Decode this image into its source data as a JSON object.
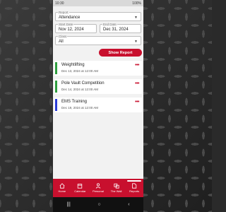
{
  "status": {
    "time": "10:30",
    "battery": "100%"
  },
  "filters": {
    "report": {
      "label": "Report",
      "value": "Attendance"
    },
    "start_date": {
      "label": "Start Date",
      "value": "Nov 12, 2024"
    },
    "end_date": {
      "label": "End Date",
      "value": "Dec 31, 2024"
    },
    "class": {
      "label": "Class",
      "value": "All"
    }
  },
  "show_report_label": "Show Report",
  "events": [
    {
      "title": "Weightlifting",
      "date": "Dec 13, 2024 at 12:00 AM",
      "color": "#2e9e3e"
    },
    {
      "title": "Pole Vault Competition",
      "date": "Dec 14, 2024 at 12:00 AM",
      "color": "#2e9e3e"
    },
    {
      "title": "EMS Training",
      "date": "Dec 19, 2024 at 12:00 AM",
      "color": "#2a3bd6"
    }
  ],
  "nav": [
    {
      "label": "Home",
      "icon": "home-icon"
    },
    {
      "label": "Calendar",
      "icon": "calendar-icon"
    },
    {
      "label": "Personal",
      "icon": "person-icon"
    },
    {
      "label": "The Wall",
      "icon": "wall-icon"
    },
    {
      "label": "Reports",
      "icon": "reports-icon",
      "active": true
    }
  ],
  "colors": {
    "accent": "#c8102e"
  }
}
